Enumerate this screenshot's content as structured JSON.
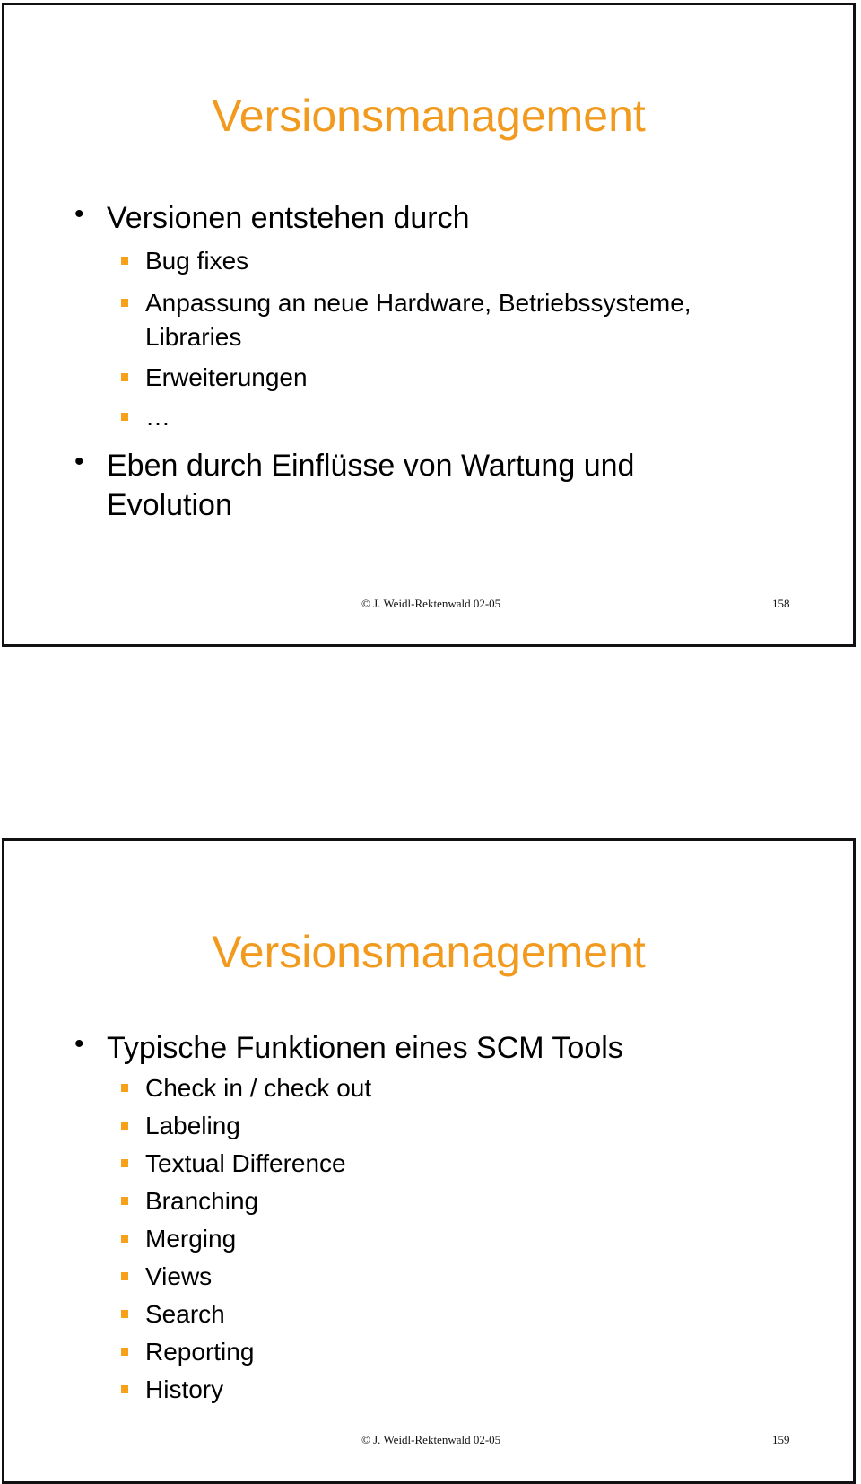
{
  "slides": [
    {
      "title": "Versionsmanagement",
      "bullets": [
        {
          "text": "Versionen entstehen durch",
          "sub": [
            "Bug fixes",
            "Anpassung an neue Hardware, Betriebssysteme,",
            "Libraries",
            "Erweiterungen",
            "…"
          ]
        },
        {
          "text_line1": "Eben durch Einflüsse von Wartung und",
          "text_line2": "Evolution"
        }
      ],
      "footer": {
        "copyright": "© J. Weidl-Rektenwald 02-05",
        "page": "158"
      }
    },
    {
      "title": "Versionsmanagement",
      "bullets": [
        {
          "text": "Typische Funktionen eines SCM Tools",
          "sub": [
            "Check in / check out",
            "Labeling",
            "Textual Difference",
            "Branching",
            "Merging",
            "Views",
            "Search",
            "Reporting",
            "History"
          ]
        }
      ],
      "footer": {
        "copyright": "© J. Weidl-Rektenwald 02-05",
        "page": "159"
      }
    }
  ],
  "colors": {
    "title": "#f29a1e",
    "bullet_square": "#f7a11a"
  }
}
